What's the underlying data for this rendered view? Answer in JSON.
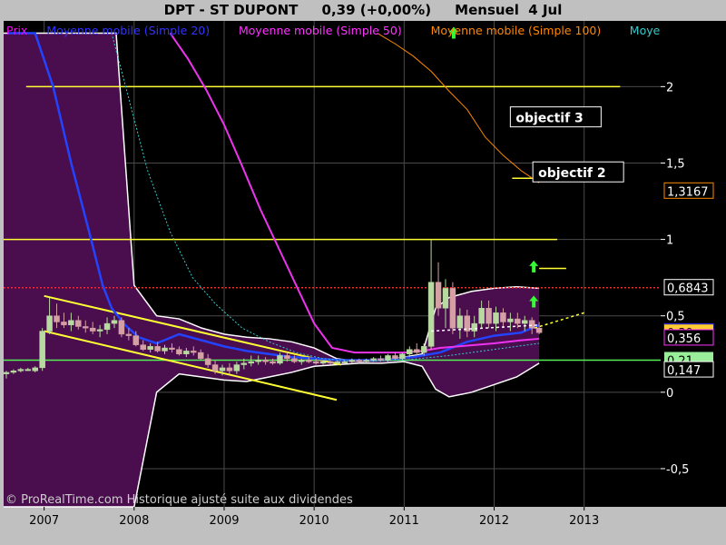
{
  "chart_data": {
    "type": "candlestick",
    "title": "DPT - ST DUPONT     0,39 (+0,00%)     Mensuel  4 Jul",
    "legend": [
      {
        "label": "Prix",
        "color": "#ff00ff"
      },
      {
        "label": "Moyenne mobile (Simple 20)",
        "color": "#3333ff"
      },
      {
        "label": "Moyenne mobile (Simple 50)",
        "color": "#ff33ff"
      },
      {
        "label": "Moyenne mobile (Simple 100)",
        "color": "#ff8800"
      },
      {
        "label": "Moye",
        "color": "#33cccc"
      }
    ],
    "y_ticks": [
      {
        "label": "2",
        "value": 2
      },
      {
        "label": "1,5",
        "value": 1.5
      },
      {
        "label": "1",
        "value": 1
      },
      {
        "label": "0,5",
        "value": 0.5
      },
      {
        "label": "0",
        "value": 0
      },
      {
        "label": "-0,5",
        "value": -0.5
      }
    ],
    "x_ticks": [
      {
        "label": "2007",
        "value": 2007.0
      },
      {
        "label": "2008",
        "value": 2008.0
      },
      {
        "label": "2009",
        "value": 2009.0
      },
      {
        "label": "2010",
        "value": 2010.0
      },
      {
        "label": "2011",
        "value": 2011.0
      },
      {
        "label": "2012",
        "value": 2012.0
      },
      {
        "label": "2013",
        "value": 2013.0
      }
    ],
    "xlim": [
      2006.55,
      2013.85
    ],
    "ylim": [
      -0.75,
      2.43
    ],
    "price_tags": [
      {
        "label": "1,3167",
        "value": 1.3167,
        "style": "outline",
        "color": "#ff8800"
      },
      {
        "label": "0,6843",
        "value": 0.6843,
        "style": "outline",
        "color": "#ffffff"
      },
      {
        "label": "0,395",
        "value": 0.395,
        "style": "outline",
        "color": "#3333ff"
      },
      {
        "label": "0,39",
        "value": 0.39,
        "style": "fill",
        "color": "#ffcc33"
      },
      {
        "label": "0,356",
        "value": 0.356,
        "style": "outline",
        "color": "#ff33ff"
      },
      {
        "label": "0,21",
        "value": 0.21,
        "style": "fill",
        "color": "#99ee99"
      },
      {
        "label": "0,147",
        "value": 0.147,
        "style": "outline",
        "color": "#ffffff"
      }
    ],
    "horizontal_lines": [
      {
        "value": 2.0,
        "x_from": 2006.8,
        "x_to": 2013.4,
        "color": "#ffff33"
      },
      {
        "value": 1.0,
        "x_from": 2006.55,
        "x_to": 2012.7,
        "color": "#ffff33"
      },
      {
        "value": 0.6843,
        "x_from": 2006.55,
        "x_to": 2013.85,
        "color": "#ff2222",
        "dashed": true
      },
      {
        "value": 0.21,
        "x_from": 2006.55,
        "x_to": 2013.85,
        "color": "#55ee55"
      },
      {
        "value": 1.4,
        "x_from": 2012.2,
        "x_to": 2012.45,
        "color": "#ffff33"
      },
      {
        "value": 0.81,
        "x_from": 2012.5,
        "x_to": 2012.8,
        "color": "#ffff33"
      }
    ],
    "annotations": [
      {
        "text": "objectif 3",
        "x": 2012.2,
        "y": 1.79
      },
      {
        "text": "objectif 2",
        "x": 2012.45,
        "y": 1.43
      }
    ],
    "channel_lines": [
      {
        "x1": 2007.0,
        "y1": 0.63,
        "x2": 2010.3,
        "y2": 0.18,
        "color": "#ffff33"
      },
      {
        "x1": 2007.0,
        "y1": 0.4,
        "x2": 2010.25,
        "y2": -0.05,
        "color": "#ffff33"
      }
    ],
    "trend_lines": [
      {
        "x1": 2011.3,
        "y1": 0.4,
        "x2": 2012.5,
        "y2": 0.44,
        "color": "#ffffff",
        "dashed": true
      },
      {
        "x1": 2012.45,
        "y1": 0.42,
        "x2": 2013.0,
        "y2": 0.52,
        "color": "#ffff33",
        "dashed": true
      }
    ],
    "arrows": [
      {
        "x": 2012.44,
        "y": 0.82,
        "color": "#33ff33"
      },
      {
        "x": 2012.44,
        "y": 0.59,
        "color": "#33ff33"
      },
      {
        "x": 2011.55,
        "y": 2.35,
        "color": "#33ff33"
      }
    ],
    "bollinger": {
      "x": [
        2006.55,
        2006.9,
        2007.25,
        2007.5,
        2007.8,
        2008.0,
        2008.25,
        2008.5,
        2008.75,
        2009.0,
        2009.25,
        2009.5,
        2009.75,
        2010.0,
        2010.25,
        2010.5,
        2010.75,
        2011.0,
        2011.2,
        2011.35,
        2011.5,
        2011.75,
        2012.0,
        2012.25,
        2012.5
      ],
      "upper": [
        2.35,
        2.35,
        2.35,
        2.35,
        2.35,
        0.7,
        0.5,
        0.48,
        0.42,
        0.38,
        0.36,
        0.35,
        0.33,
        0.29,
        0.22,
        0.2,
        0.21,
        0.23,
        0.25,
        0.55,
        0.62,
        0.66,
        0.68,
        0.69,
        0.68
      ],
      "lower": [
        -0.75,
        -0.75,
        -0.75,
        -0.75,
        -0.75,
        -0.75,
        0.0,
        0.12,
        0.1,
        0.08,
        0.07,
        0.1,
        0.13,
        0.17,
        0.18,
        0.19,
        0.19,
        0.2,
        0.17,
        0.02,
        -0.03,
        0.0,
        0.05,
        0.1,
        0.19
      ]
    },
    "ma_series": [
      {
        "name": "Moyenne mobile (Simple 20)",
        "color": "#2244ff",
        "width": 2.5,
        "x": [
          2006.6,
          2006.75,
          2006.9,
          2007.1,
          2007.3,
          2007.5,
          2007.65,
          2007.75,
          2007.9,
          2008.05,
          2008.25,
          2008.5,
          2008.75,
          2009.0,
          2009.25,
          2009.5,
          2009.75,
          2010.0,
          2010.3,
          2010.6,
          2010.9,
          2011.1,
          2011.4,
          2011.7,
          2012.0,
          2012.3,
          2012.5
        ],
        "y": [
          2.35,
          2.35,
          2.35,
          2.0,
          1.5,
          1.05,
          0.7,
          0.55,
          0.44,
          0.36,
          0.32,
          0.38,
          0.34,
          0.3,
          0.27,
          0.25,
          0.23,
          0.22,
          0.21,
          0.21,
          0.22,
          0.23,
          0.26,
          0.33,
          0.37,
          0.39,
          0.44
        ]
      },
      {
        "name": "Moyenne mobile (Simple 50)",
        "color": "#ee33ee",
        "width": 2,
        "x": [
          2008.4,
          2008.6,
          2008.8,
          2009.0,
          2009.2,
          2009.4,
          2009.6,
          2009.8,
          2010.0,
          2010.2,
          2010.45,
          2010.7,
          2011.0,
          2011.2,
          2011.4,
          2011.6,
          2012.0,
          2012.3,
          2012.5
        ],
        "y": [
          2.35,
          2.18,
          1.98,
          1.75,
          1.48,
          1.2,
          0.95,
          0.7,
          0.45,
          0.29,
          0.26,
          0.26,
          0.26,
          0.27,
          0.29,
          0.3,
          0.32,
          0.34,
          0.35
        ]
      },
      {
        "name": "Moyenne mobile (Simple 100)",
        "color": "#ff8800",
        "width": 1,
        "x": [
          2010.7,
          2010.9,
          2011.1,
          2011.3,
          2011.5,
          2011.7,
          2011.9,
          2012.1,
          2012.3,
          2012.5
        ],
        "y": [
          2.35,
          2.28,
          2.2,
          2.1,
          1.97,
          1.85,
          1.67,
          1.55,
          1.45,
          1.37
        ]
      },
      {
        "name": "Moye",
        "color": "#33cccc",
        "width": 1,
        "dashed": true,
        "x": [
          2007.75,
          2007.95,
          2008.15,
          2008.4,
          2008.65,
          2008.9,
          2009.2,
          2009.5,
          2009.8,
          2010.1,
          2010.5,
          2011.0,
          2011.5,
          2012.0,
          2012.5
        ],
        "y": [
          2.35,
          1.9,
          1.45,
          1.05,
          0.75,
          0.58,
          0.42,
          0.33,
          0.26,
          0.22,
          0.2,
          0.21,
          0.24,
          0.28,
          0.32
        ]
      }
    ],
    "candles": [
      {
        "t": 2006.58,
        "o": 0.12,
        "h": 0.14,
        "l": 0.09,
        "c": 0.13
      },
      {
        "t": 2006.66,
        "o": 0.13,
        "h": 0.15,
        "l": 0.12,
        "c": 0.14
      },
      {
        "t": 2006.74,
        "o": 0.14,
        "h": 0.16,
        "l": 0.13,
        "c": 0.15
      },
      {
        "t": 2006.82,
        "o": 0.15,
        "h": 0.16,
        "l": 0.14,
        "c": 0.15
      },
      {
        "t": 2006.9,
        "o": 0.14,
        "h": 0.17,
        "l": 0.13,
        "c": 0.16
      },
      {
        "t": 2006.98,
        "o": 0.16,
        "h": 0.42,
        "l": 0.14,
        "c": 0.4
      },
      {
        "t": 2007.06,
        "o": 0.4,
        "h": 0.62,
        "l": 0.38,
        "c": 0.5
      },
      {
        "t": 2007.14,
        "o": 0.5,
        "h": 0.58,
        "l": 0.42,
        "c": 0.46
      },
      {
        "t": 2007.22,
        "o": 0.46,
        "h": 0.52,
        "l": 0.42,
        "c": 0.44
      },
      {
        "t": 2007.3,
        "o": 0.44,
        "h": 0.52,
        "l": 0.4,
        "c": 0.47
      },
      {
        "t": 2007.38,
        "o": 0.47,
        "h": 0.5,
        "l": 0.41,
        "c": 0.43
      },
      {
        "t": 2007.46,
        "o": 0.43,
        "h": 0.47,
        "l": 0.39,
        "c": 0.42
      },
      {
        "t": 2007.54,
        "o": 0.42,
        "h": 0.46,
        "l": 0.38,
        "c": 0.4
      },
      {
        "t": 2007.62,
        "o": 0.4,
        "h": 0.44,
        "l": 0.36,
        "c": 0.41
      },
      {
        "t": 2007.7,
        "o": 0.41,
        "h": 0.49,
        "l": 0.38,
        "c": 0.45
      },
      {
        "t": 2007.78,
        "o": 0.45,
        "h": 0.5,
        "l": 0.42,
        "c": 0.47
      },
      {
        "t": 2007.86,
        "o": 0.47,
        "h": 0.49,
        "l": 0.36,
        "c": 0.38
      },
      {
        "t": 2007.94,
        "o": 0.38,
        "h": 0.42,
        "l": 0.34,
        "c": 0.37
      },
      {
        "t": 2008.02,
        "o": 0.37,
        "h": 0.4,
        "l": 0.3,
        "c": 0.31
      },
      {
        "t": 2008.1,
        "o": 0.31,
        "h": 0.34,
        "l": 0.27,
        "c": 0.28
      },
      {
        "t": 2008.18,
        "o": 0.28,
        "h": 0.32,
        "l": 0.26,
        "c": 0.3
      },
      {
        "t": 2008.26,
        "o": 0.3,
        "h": 0.33,
        "l": 0.26,
        "c": 0.27
      },
      {
        "t": 2008.34,
        "o": 0.27,
        "h": 0.31,
        "l": 0.25,
        "c": 0.29
      },
      {
        "t": 2008.42,
        "o": 0.29,
        "h": 0.32,
        "l": 0.26,
        "c": 0.28
      },
      {
        "t": 2008.5,
        "o": 0.28,
        "h": 0.3,
        "l": 0.24,
        "c": 0.25
      },
      {
        "t": 2008.58,
        "o": 0.25,
        "h": 0.29,
        "l": 0.23,
        "c": 0.27
      },
      {
        "t": 2008.66,
        "o": 0.27,
        "h": 0.3,
        "l": 0.24,
        "c": 0.26
      },
      {
        "t": 2008.74,
        "o": 0.26,
        "h": 0.28,
        "l": 0.21,
        "c": 0.22
      },
      {
        "t": 2008.82,
        "o": 0.22,
        "h": 0.25,
        "l": 0.16,
        "c": 0.18
      },
      {
        "t": 2008.9,
        "o": 0.18,
        "h": 0.21,
        "l": 0.12,
        "c": 0.14
      },
      {
        "t": 2008.98,
        "o": 0.14,
        "h": 0.18,
        "l": 0.11,
        "c": 0.16
      },
      {
        "t": 2009.06,
        "o": 0.16,
        "h": 0.19,
        "l": 0.12,
        "c": 0.14
      },
      {
        "t": 2009.14,
        "o": 0.14,
        "h": 0.2,
        "l": 0.12,
        "c": 0.18
      },
      {
        "t": 2009.22,
        "o": 0.18,
        "h": 0.22,
        "l": 0.15,
        "c": 0.19
      },
      {
        "t": 2009.3,
        "o": 0.19,
        "h": 0.24,
        "l": 0.17,
        "c": 0.2
      },
      {
        "t": 2009.38,
        "o": 0.2,
        "h": 0.24,
        "l": 0.18,
        "c": 0.21
      },
      {
        "t": 2009.46,
        "o": 0.21,
        "h": 0.23,
        "l": 0.18,
        "c": 0.2
      },
      {
        "t": 2009.54,
        "o": 0.2,
        "h": 0.22,
        "l": 0.18,
        "c": 0.19
      },
      {
        "t": 2009.62,
        "o": 0.19,
        "h": 0.26,
        "l": 0.18,
        "c": 0.24
      },
      {
        "t": 2009.7,
        "o": 0.24,
        "h": 0.26,
        "l": 0.2,
        "c": 0.22
      },
      {
        "t": 2009.78,
        "o": 0.22,
        "h": 0.24,
        "l": 0.19,
        "c": 0.2
      },
      {
        "t": 2009.86,
        "o": 0.2,
        "h": 0.22,
        "l": 0.18,
        "c": 0.21
      },
      {
        "t": 2009.94,
        "o": 0.21,
        "h": 0.23,
        "l": 0.19,
        "c": 0.2
      },
      {
        "t": 2010.02,
        "o": 0.2,
        "h": 0.22,
        "l": 0.18,
        "c": 0.19
      },
      {
        "t": 2010.1,
        "o": 0.19,
        "h": 0.21,
        "l": 0.18,
        "c": 0.2
      },
      {
        "t": 2010.18,
        "o": 0.2,
        "h": 0.21,
        "l": 0.18,
        "c": 0.19
      },
      {
        "t": 2010.26,
        "o": 0.19,
        "h": 0.21,
        "l": 0.18,
        "c": 0.2
      },
      {
        "t": 2010.34,
        "o": 0.2,
        "h": 0.21,
        "l": 0.19,
        "c": 0.2
      },
      {
        "t": 2010.42,
        "o": 0.2,
        "h": 0.22,
        "l": 0.19,
        "c": 0.21
      },
      {
        "t": 2010.5,
        "o": 0.21,
        "h": 0.22,
        "l": 0.19,
        "c": 0.2
      },
      {
        "t": 2010.58,
        "o": 0.2,
        "h": 0.22,
        "l": 0.19,
        "c": 0.21
      },
      {
        "t": 2010.66,
        "o": 0.21,
        "h": 0.23,
        "l": 0.2,
        "c": 0.22
      },
      {
        "t": 2010.74,
        "o": 0.22,
        "h": 0.24,
        "l": 0.2,
        "c": 0.21
      },
      {
        "t": 2010.82,
        "o": 0.21,
        "h": 0.25,
        "l": 0.2,
        "c": 0.24
      },
      {
        "t": 2010.9,
        "o": 0.24,
        "h": 0.26,
        "l": 0.21,
        "c": 0.22
      },
      {
        "t": 2010.98,
        "o": 0.22,
        "h": 0.26,
        "l": 0.21,
        "c": 0.25
      },
      {
        "t": 2011.06,
        "o": 0.25,
        "h": 0.3,
        "l": 0.23,
        "c": 0.28
      },
      {
        "t": 2011.14,
        "o": 0.28,
        "h": 0.32,
        "l": 0.24,
        "c": 0.26
      },
      {
        "t": 2011.22,
        "o": 0.26,
        "h": 0.32,
        "l": 0.24,
        "c": 0.3
      },
      {
        "t": 2011.3,
        "o": 0.3,
        "h": 1.0,
        "l": 0.28,
        "c": 0.72
      },
      {
        "t": 2011.38,
        "o": 0.72,
        "h": 0.85,
        "l": 0.5,
        "c": 0.55
      },
      {
        "t": 2011.46,
        "o": 0.55,
        "h": 0.74,
        "l": 0.42,
        "c": 0.68
      },
      {
        "t": 2011.54,
        "o": 0.68,
        "h": 0.72,
        "l": 0.38,
        "c": 0.42
      },
      {
        "t": 2011.62,
        "o": 0.42,
        "h": 0.55,
        "l": 0.35,
        "c": 0.5
      },
      {
        "t": 2011.7,
        "o": 0.5,
        "h": 0.54,
        "l": 0.36,
        "c": 0.4
      },
      {
        "t": 2011.78,
        "o": 0.4,
        "h": 0.5,
        "l": 0.36,
        "c": 0.45
      },
      {
        "t": 2011.86,
        "o": 0.45,
        "h": 0.6,
        "l": 0.42,
        "c": 0.55
      },
      {
        "t": 2011.94,
        "o": 0.55,
        "h": 0.6,
        "l": 0.42,
        "c": 0.45
      },
      {
        "t": 2012.02,
        "o": 0.45,
        "h": 0.56,
        "l": 0.4,
        "c": 0.52
      },
      {
        "t": 2012.1,
        "o": 0.52,
        "h": 0.55,
        "l": 0.42,
        "c": 0.46
      },
      {
        "t": 2012.18,
        "o": 0.46,
        "h": 0.52,
        "l": 0.4,
        "c": 0.48
      },
      {
        "t": 2012.26,
        "o": 0.48,
        "h": 0.52,
        "l": 0.42,
        "c": 0.45
      },
      {
        "t": 2012.34,
        "o": 0.45,
        "h": 0.5,
        "l": 0.4,
        "c": 0.47
      },
      {
        "t": 2012.42,
        "o": 0.47,
        "h": 0.49,
        "l": 0.38,
        "c": 0.42
      },
      {
        "t": 2012.5,
        "o": 0.42,
        "h": 0.46,
        "l": 0.38,
        "c": 0.39
      }
    ]
  },
  "copyright": "© ProRealTime.com Historique ajusté suite aux dividendes",
  "colors": {
    "outer_background": "#c0c0c0",
    "plot_background": "#000000",
    "band_fill": "#4a0d4e",
    "band_edge": "#ffffff",
    "grid": "#4a4a4a",
    "candle_up": "#b8d9a0",
    "candle_down": "#d4a0a4",
    "axis_text": "#ffffff",
    "x_axis_text": "#000000"
  }
}
